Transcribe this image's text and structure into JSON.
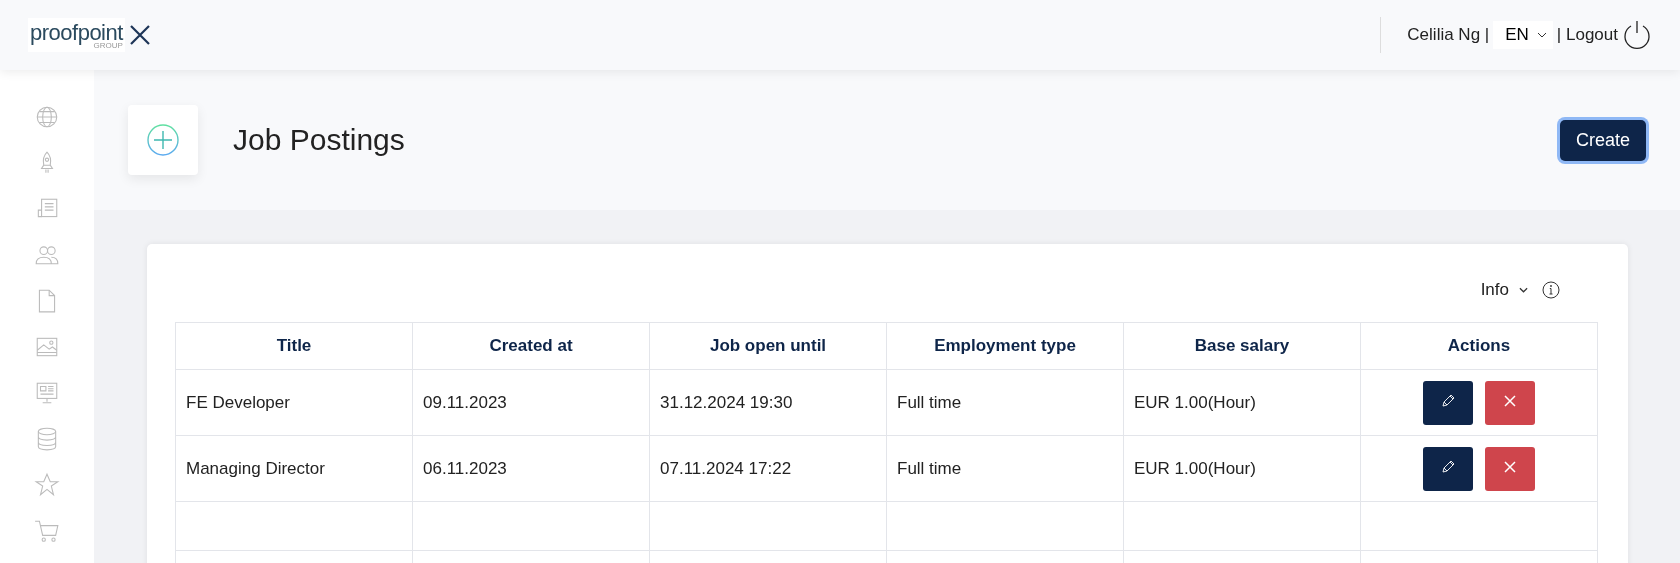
{
  "header": {
    "logo_text": "proofpoint",
    "logo_subtext": "GROUP",
    "user": "Celilia Ng |",
    "language": "EN",
    "logout": "| Logout"
  },
  "page": {
    "title": "Job Postings",
    "create_button": "Create"
  },
  "table": {
    "info": "Info",
    "columns": [
      "Title",
      "Created at",
      "Job open until",
      "Employment type",
      "Base salary",
      "Actions"
    ],
    "rows": [
      {
        "cells": [
          "FE Developer",
          "09.11.2023",
          "31.12.2024 19:30",
          "Full time",
          "EUR 1.00(Hour)"
        ]
      },
      {
        "cells": [
          "Managing Director",
          "06.11.2023",
          "07.11.2024 17:22",
          "Full time",
          "EUR 1.00(Hour)"
        ]
      }
    ]
  }
}
